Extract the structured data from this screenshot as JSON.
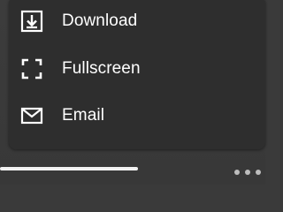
{
  "menu": {
    "items": [
      {
        "label": "Download",
        "icon": "download-icon"
      },
      {
        "label": "Fullscreen",
        "icon": "fullscreen-icon"
      },
      {
        "label": "Email",
        "icon": "email-icon"
      }
    ]
  },
  "player": {
    "progress_fraction": 0.65,
    "more_icon": "more-horizontal-icon"
  },
  "colors": {
    "menu_background": "#2e2e2e",
    "text": "#ffffff",
    "progress": "#f2f2f2",
    "more_dots": "#bdbdbd"
  }
}
